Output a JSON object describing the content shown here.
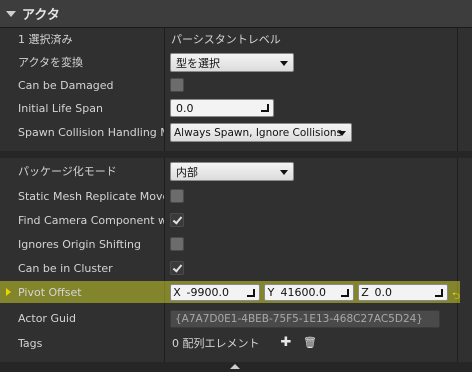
{
  "category": {
    "title": "アクタ"
  },
  "rows": {
    "selected_count": {
      "label": "1 選択済み",
      "value": "パーシスタントレベル"
    },
    "convert_actor": {
      "label": "アクタを変換",
      "value": "型を選択"
    },
    "can_be_damaged": {
      "label": "Can be Damaged",
      "checked": false
    },
    "initial_life_span": {
      "label": "Initial Life Span",
      "value": "0.0"
    },
    "spawn_collision": {
      "label": "Spawn Collision Handling Method",
      "value": "Always Spawn, Ignore Collisions"
    },
    "package_mode": {
      "label": "パッケージ化モード",
      "value": "内部"
    },
    "static_mesh_replicate": {
      "label": "Static Mesh Replicate Movement",
      "checked": false
    },
    "find_camera_component": {
      "label": "Find Camera Component when ViewTarget",
      "checked": true
    },
    "ignores_origin_shifting": {
      "label": "Ignores Origin Shifting",
      "checked": false
    },
    "can_be_in_cluster": {
      "label": "Can be in Cluster",
      "checked": true
    },
    "pivot_offset": {
      "label": "Pivot Offset",
      "x_axis": "X",
      "x": "-9900.0",
      "y_axis": "Y",
      "y": "41600.0",
      "z_axis": "Z",
      "z": "0.0",
      "reset_glyph": "⮌"
    },
    "actor_guid": {
      "label": "Actor Guid",
      "value": "{A7A7D0E1-4BEB-75F5-1E13-468C27AC5D24}"
    },
    "tags": {
      "label": "Tags",
      "value": "0 配列エレメント",
      "add_glyph": "✚",
      "delete_glyph": "🗑"
    }
  },
  "colors": {
    "highlight": "#e8ee2a",
    "panel": "#303030",
    "header": "#3d3d3d"
  },
  "icons": [
    "collapse-arrow-icon",
    "dropdown-arrow-icon",
    "checkmark-icon",
    "add-icon",
    "trash-icon",
    "reset-to-default-icon",
    "expand-up-icon"
  ]
}
